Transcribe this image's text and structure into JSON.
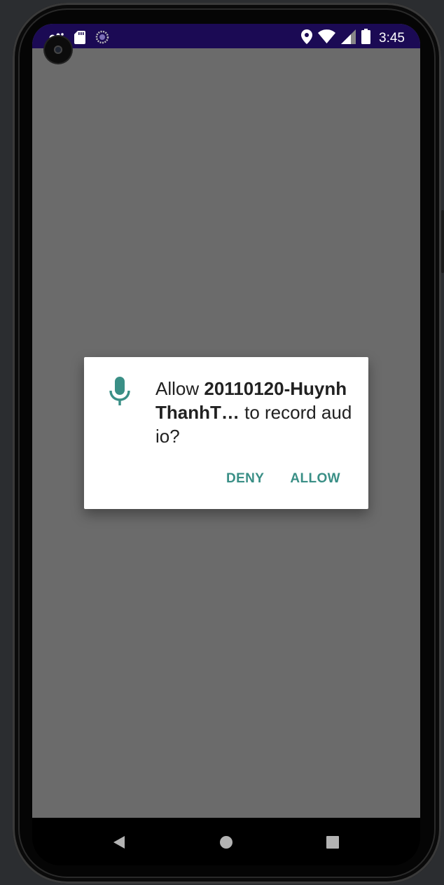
{
  "status_bar": {
    "time": "3:45",
    "left_icons": [
      "notification-dots-icon",
      "sd-card-icon",
      "sync-progress-icon"
    ],
    "right_icons": [
      "location-icon",
      "wifi-icon",
      "cell-signal-icon",
      "battery-icon"
    ],
    "background_color": "#1b0a54"
  },
  "permission_dialog": {
    "icon": "microphone-icon",
    "accent_color": "#3a8f86",
    "message_prefix": "Allow ",
    "app_name": "20110120-HuynhThanhT…",
    "message_suffix": " to record audio?",
    "deny_label": "DENY",
    "allow_label": "ALLOW"
  },
  "navigation_bar": {
    "buttons": [
      "back-icon",
      "home-icon",
      "recents-icon"
    ]
  },
  "screen": {
    "background_color": "#6b6b6b"
  }
}
